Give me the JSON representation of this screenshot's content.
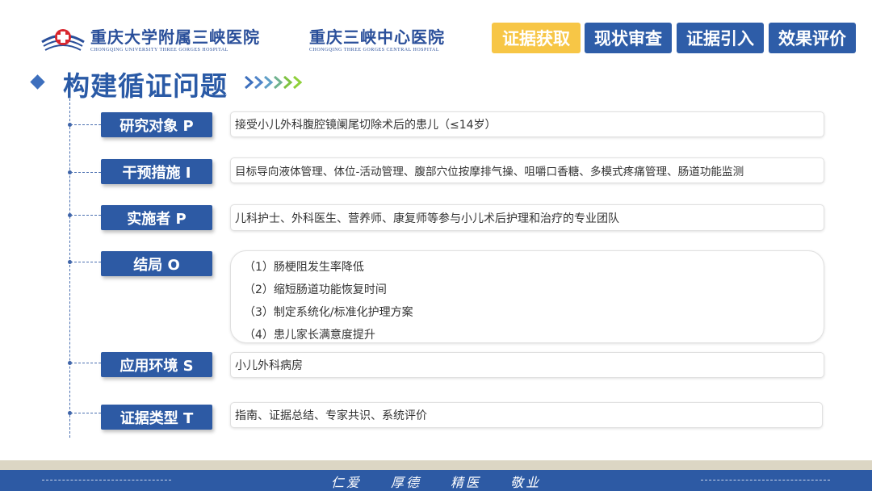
{
  "header": {
    "hospital_1": {
      "cn": "重庆大学附属三峡医院",
      "en": "CHONGQING UNIVERSITY THREE GORGES HOSPITAL"
    },
    "hospital_2": {
      "cn": "重庆三峡中心医院",
      "en": "CHONGQING THREE GORGES CENTRAL HOSPITAL"
    },
    "nav": [
      {
        "label": "证据获取",
        "active": true
      },
      {
        "label": "现状审查",
        "active": false
      },
      {
        "label": "证据引入",
        "active": false
      },
      {
        "label": "效果评价",
        "active": false
      }
    ]
  },
  "title": "构建循证问题",
  "items": [
    {
      "label": "研究对象 P",
      "content": "接受小儿外科腹腔镜阑尾切除术后的患儿（≤14岁）"
    },
    {
      "label": "干预措施 I",
      "content": "目标导向液体管理、体位-活动管理、腹部穴位按摩排气操、咀嚼口香糖、多模式疼痛管理、肠道功能监测"
    },
    {
      "label": "实施者 P",
      "content": "儿科护士、外科医生、营养师、康复师等参与小儿术后护理和治疗的专业团队"
    },
    {
      "label": "结局 O",
      "content": [
        "（1）肠梗阻发生率降低",
        "（2）缩短肠道功能恢复时间",
        "（3）制定系统化/标准化护理方案",
        "（4）患儿家长满意度提升"
      ]
    },
    {
      "label": "应用环境 S",
      "content": "小儿外科病房"
    },
    {
      "label": "证据类型 T",
      "content": "指南、证据总结、专家共识、系统评价"
    }
  ],
  "footer": {
    "motto": [
      "仁爱",
      "厚德",
      "精医",
      "敬业"
    ]
  },
  "colors": {
    "primary": "#2d5aa4",
    "accent": "#f7c646",
    "chevron": "#7fc241"
  }
}
